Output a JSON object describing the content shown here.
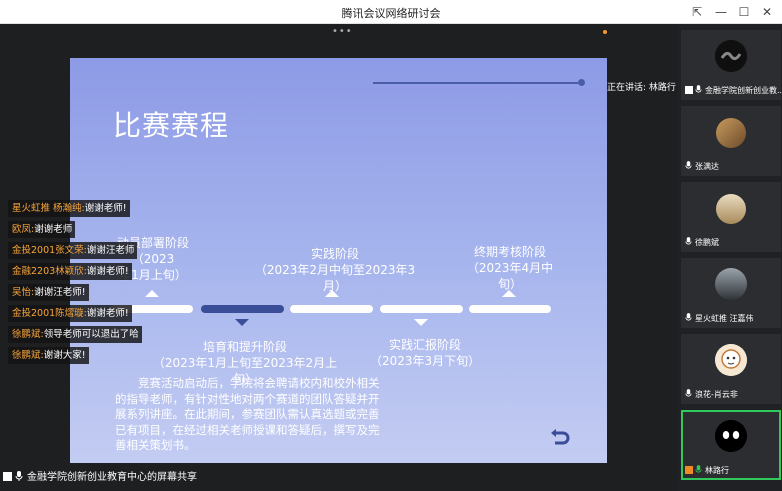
{
  "window": {
    "title": "腾讯会议网络研讨会",
    "controls": [
      "⇱",
      "—",
      "☐",
      "✕"
    ]
  },
  "slide": {
    "title": "比赛赛程",
    "phases_top": [
      {
        "name": "动员部署阶段（2023",
        "date": "年1月上旬）"
      },
      {
        "name": "实践阶段",
        "date": "（2023年2月中旬至2023年3月）"
      },
      {
        "name": "终期考核阶段",
        "date": "（2023年4月中旬）"
      }
    ],
    "phases_bottom": [
      {
        "name": "培育和提升阶段",
        "date": "（2023年1月上旬至2023年2月上旬）"
      },
      {
        "name": "实践汇报阶段",
        "date": "（2023年3月下旬）"
      }
    ],
    "description": "竞赛活动启动后，学院将会聘请校内和校外相关的指导老师，有针对性地对两个赛道的团队答疑并开展系列讲座。在此期间，参赛团队需认真选题或完善已有项目，在经过相关老师授课和答疑后，撰写及完善相关策划书。",
    "colors": {
      "accent": "#3a4d98",
      "bg_top": "#8d9ae6",
      "bg_bottom": "#c3ccf2"
    }
  },
  "chat": [
    {
      "sender": "星火虹推 杨瀚纯:",
      "text": "谢谢老师!"
    },
    {
      "sender": "欧凤:",
      "text": "谢谢老师"
    },
    {
      "sender": "金投2001张文荣:",
      "text": "谢谢汪老师"
    },
    {
      "sender": "金融2203林颖欣:",
      "text": "谢谢老师!"
    },
    {
      "sender": "吴怡:",
      "text": "谢谢汪老师!"
    },
    {
      "sender": "金投2001陈熠璇:",
      "text": "谢谢老师!"
    },
    {
      "sender": "徐鹏斌:",
      "text": "领导老师可以退出了哈"
    },
    {
      "sender": "徐鹏斌:",
      "text": "谢谢大家!"
    }
  ],
  "speaking": {
    "label": "正在讲话:",
    "name": "林路行"
  },
  "share_label": "金融学院创新创业教育中心的屏幕共享",
  "participants": [
    {
      "name": "金融学院创新创业教...",
      "icon": "screen-share-icon"
    },
    {
      "name": "张满达",
      "icon": "avatar-photo"
    },
    {
      "name": "徐鹏斌",
      "icon": "avatar-photo"
    },
    {
      "name": "星火虹推 汪嘉伟",
      "icon": "avatar-photo"
    },
    {
      "name": "浪花-肖云非",
      "icon": "avatar-photo"
    },
    {
      "name": "林路行",
      "icon": "avatar-panda"
    }
  ]
}
